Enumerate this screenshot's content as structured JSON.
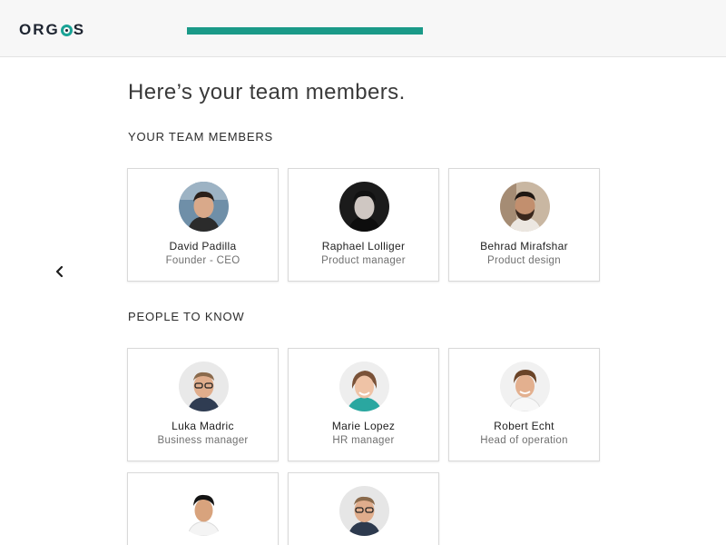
{
  "header": {
    "logo_text": "ORGOS",
    "progress": 1.0
  },
  "page": {
    "title": "Here’s your team members."
  },
  "sections": {
    "team": {
      "label": "YOUR TEAM MEMBERS",
      "members": [
        {
          "name": "David Padilla",
          "role": "Founder - CEO"
        },
        {
          "name": "Raphael Lolliger",
          "role": "Product manager"
        },
        {
          "name": "Behrad Mirafshar",
          "role": "Product design"
        }
      ]
    },
    "people": {
      "label": "PEOPLE TO KNOW",
      "members": [
        {
          "name": "Luka Madric",
          "role": "Business manager"
        },
        {
          "name": "Marie Lopez",
          "role": "HR manager"
        },
        {
          "name": "Robert Echt",
          "role": "Head of operation"
        },
        {
          "name": "",
          "role": ""
        },
        {
          "name": "",
          "role": ""
        }
      ]
    }
  },
  "colors": {
    "accent": "#1a9a88",
    "logo_ring": "#1aa396"
  },
  "icons": {
    "back": "chevron-left-icon"
  }
}
